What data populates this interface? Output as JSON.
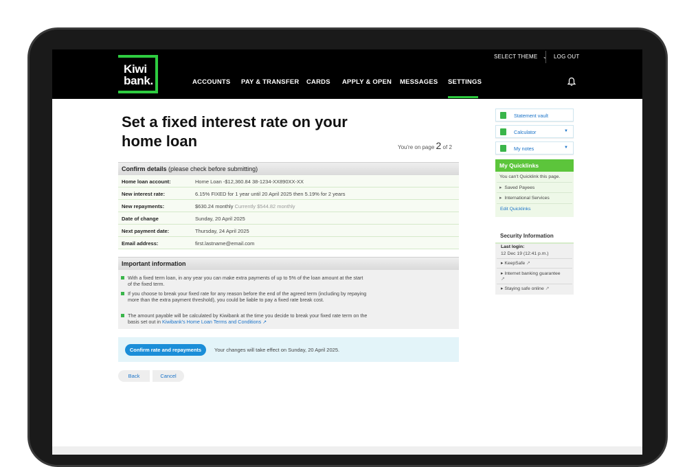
{
  "header": {
    "logo_line1": "Kiwi",
    "logo_line2": "bank.",
    "select_theme": "SELECT THEME",
    "logout": "LOG OUT",
    "nav": [
      "ACCOUNTS",
      "PAY & TRANSFER",
      "CARDS",
      "APPLY & OPEN",
      "MESSAGES",
      "SETTINGS"
    ],
    "active_nav": "SETTINGS",
    "accent": "#2ecc40"
  },
  "page": {
    "title": "Set a fixed interest rate on your home loan",
    "page_prefix": "You're on page",
    "page_current": "2",
    "page_suffix": "of 2"
  },
  "confirm_details": {
    "heading_bold": "Confirm details",
    "heading_rest": "(please check before submitting)",
    "rows": [
      {
        "label": "Home loan account:",
        "value": "Home Loan  -$12,360.84  38-1234-XX890XX-XX",
        "muted": ""
      },
      {
        "label": "New interest rate:",
        "value": "6.15% FIXED for 1 year until 20 April 2025 then 5.19% for 2 years",
        "muted": ""
      },
      {
        "label": "New repayments:",
        "value": "$630.24 monthly",
        "muted": "Currently $544.82 monthly"
      },
      {
        "label": "Date of change",
        "value": "Sunday, 20 April 2025",
        "muted": ""
      },
      {
        "label": "Next payment date:",
        "value": "Thursday, 24 April 2025",
        "muted": ""
      },
      {
        "label": "Email address:",
        "value": "first.lastname@email.com",
        "muted": ""
      }
    ]
  },
  "important": {
    "heading": "Important information",
    "bullets": [
      "With a fixed term loan, in any year you can make extra payments of up to 5% of the loan amount at the start of the fixed term.",
      "If you choose to break your fixed rate for any reason before the end of the agreed term (including by repaying more than the extra payment threshold), you could be liable to pay a fixed rate break cost.",
      "The amount payable will be calculated by Kiwibank at the time you decide to break your fixed rate term on the basis set out in"
    ],
    "link": "Kiwibank's Home Loan Terms and Conditions"
  },
  "actions": {
    "confirm": "Confirm rate and repayments",
    "effect": "Your changes will take effect on Sunday, 20 April 2025.",
    "back": "Back",
    "cancel": "Cancel"
  },
  "sidebar": {
    "links": [
      "Statement vault",
      "Calculator",
      "My notes"
    ],
    "quicklinks_title": "My Quicklinks",
    "quicklinks_note": "You can't Quicklink this page.",
    "quicklinks": [
      "Saved Payees",
      "International Services"
    ],
    "edit_quicklinks": "Edit Quicklinks",
    "security_title": "Security Information",
    "last_login_label": "Last login:",
    "last_login_value": "12 Dec 19 (12:41 p.m.)",
    "security_links": [
      "KeepSafe",
      "Internet banking guarantee",
      "Staying safe online"
    ]
  }
}
